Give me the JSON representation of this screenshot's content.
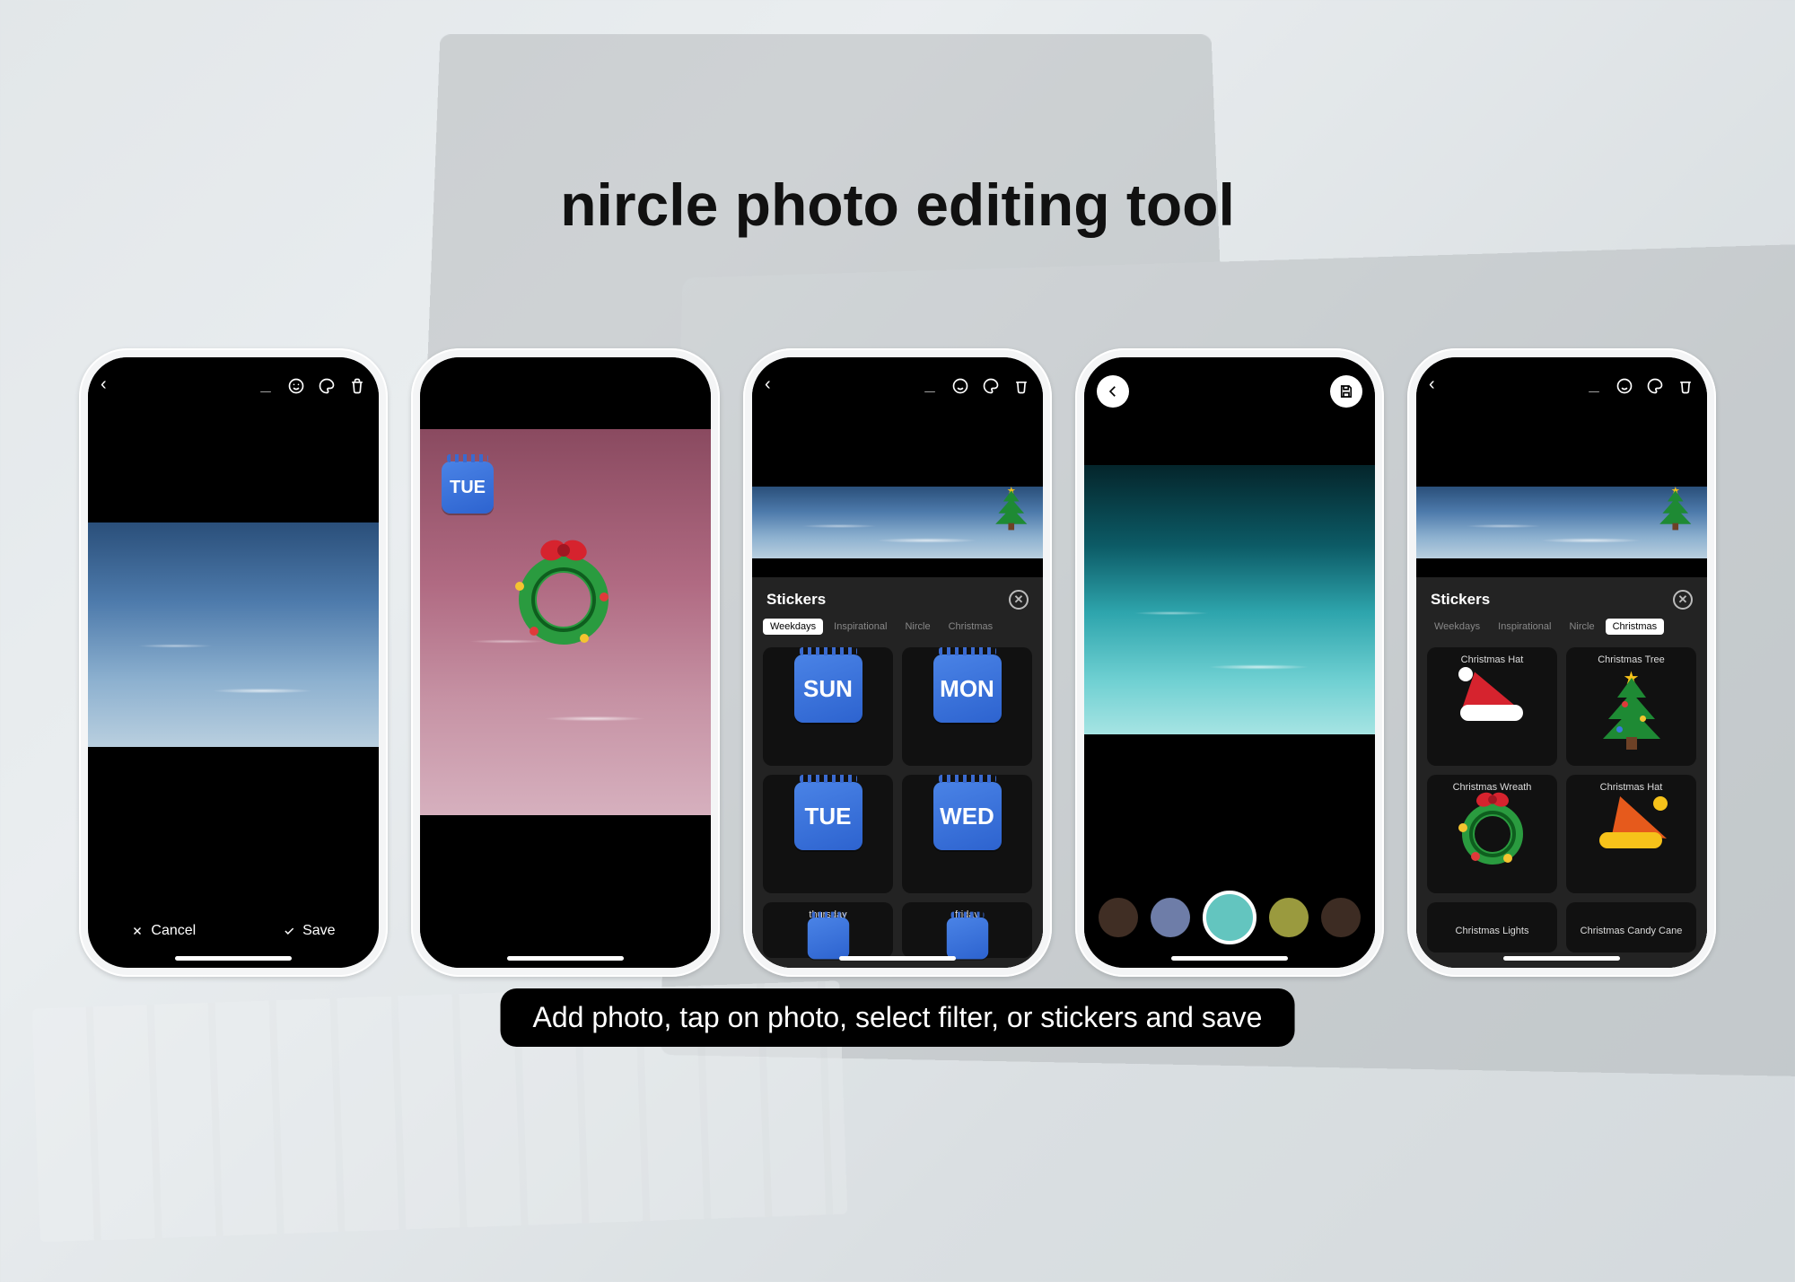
{
  "title": "nircle photo editing tool",
  "caption": "Add photo, tap on photo, select filter, or stickers and save",
  "toolbar": {
    "back": "‹",
    "download_icon": "download",
    "emoji_icon": "emoji",
    "palette_icon": "palette",
    "delete_icon": "trash"
  },
  "phone1": {
    "cancel_label": "Cancel",
    "save_label": "Save"
  },
  "phone2": {
    "sticker_text": "TUE"
  },
  "stickers_panel": {
    "title": "Stickers",
    "tabs": [
      "Weekdays",
      "Inspirational",
      "Nircle",
      "Christmas"
    ]
  },
  "phone3": {
    "active_tab": "Weekdays",
    "items": [
      {
        "label": "sunday",
        "short": "SUN"
      },
      {
        "label": "monday",
        "short": "MON"
      },
      {
        "label": "tuesday",
        "short": "TUE"
      },
      {
        "label": "wednesday",
        "short": "WED"
      },
      {
        "label": "thursday",
        "short": ""
      },
      {
        "label": "friday",
        "short": ""
      }
    ]
  },
  "phone4": {
    "filter_colors": [
      "#402e24",
      "#6e7da8",
      "#63c5bf",
      "#9a9a3e",
      "#3d2c23"
    ],
    "selected_filter_index": 2
  },
  "phone5": {
    "active_tab": "Christmas",
    "items": [
      {
        "label": "Christmas Hat",
        "kind": "hat"
      },
      {
        "label": "Christmas Tree",
        "kind": "tree"
      },
      {
        "label": "Christmas Wreath",
        "kind": "wreath"
      },
      {
        "label": "Christmas Hat",
        "kind": "hat-alt"
      },
      {
        "label": "Christmas Lights",
        "kind": "none"
      },
      {
        "label": "Christmas Candy Cane",
        "kind": "none"
      }
    ]
  }
}
